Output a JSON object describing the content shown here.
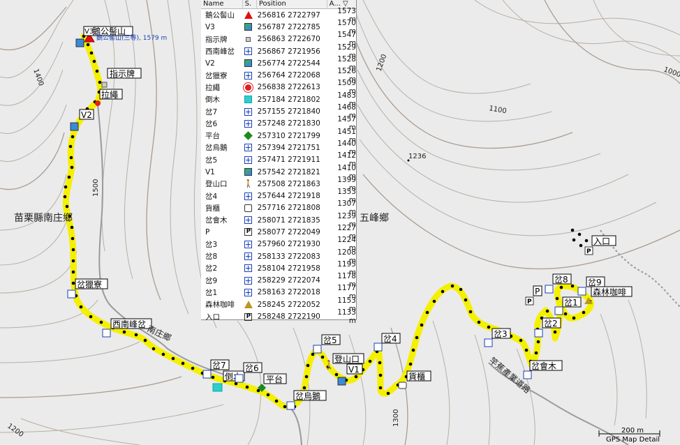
{
  "table": {
    "headers": {
      "name": "Name",
      "symbol": "S.",
      "position": "Position",
      "altitude": "A... ▽"
    },
    "rows": [
      {
        "name": "鵝公髻山",
        "icon": "summit-triangle-icon",
        "position": "256816 2722797",
        "alt": "1573 m"
      },
      {
        "name": "V3",
        "icon": "flag-icon",
        "position": "256787 2722785",
        "alt": "1570 m"
      },
      {
        "name": "指示牌",
        "icon": "sign-square-icon",
        "position": "256863 2722670",
        "alt": "1547 m"
      },
      {
        "name": "西南峰岔",
        "icon": "junction-plus-icon",
        "position": "256867 2721956",
        "alt": "1529 m"
      },
      {
        "name": "V2",
        "icon": "flag-icon",
        "position": "256774 2722544",
        "alt": "1528 m"
      },
      {
        "name": "岔獵寮",
        "icon": "junction-plus-icon",
        "position": "256764 2722068",
        "alt": "1526 m"
      },
      {
        "name": "拉繩",
        "icon": "red-sun-icon",
        "position": "256838 2722613",
        "alt": "1509 m"
      },
      {
        "name": "倒木",
        "icon": "tree-icon",
        "position": "257184 2721802",
        "alt": "1483 m"
      },
      {
        "name": "岔7",
        "icon": "junction-plus-icon",
        "position": "257155 2721840",
        "alt": "1468 m"
      },
      {
        "name": "岔6",
        "icon": "junction-plus-icon",
        "position": "257248 2721830",
        "alt": "1457 m"
      },
      {
        "name": "平台",
        "icon": "green-diamond-icon",
        "position": "257310 2721799",
        "alt": "1451 m"
      },
      {
        "name": "岔烏鵝",
        "icon": "junction-plus-icon",
        "position": "257394 2721751",
        "alt": "1440 m"
      },
      {
        "name": "岔5",
        "icon": "junction-plus-icon",
        "position": "257471 2721911",
        "alt": "1412 m"
      },
      {
        "name": "V1",
        "icon": "flag-icon",
        "position": "257542 2721821",
        "alt": "1410 m"
      },
      {
        "name": "登山口",
        "icon": "hiker-icon",
        "position": "257508 2721863",
        "alt": "1399 m"
      },
      {
        "name": "岔4",
        "icon": "junction-plus-icon",
        "position": "257644 2721918",
        "alt": "1353 m"
      },
      {
        "name": "貨櫃",
        "icon": "container-icon",
        "position": "257716 2721808",
        "alt": "1307 m"
      },
      {
        "name": "岔會木",
        "icon": "junction-plus-icon",
        "position": "258071 2721835",
        "alt": "1239 m"
      },
      {
        "name": "P",
        "icon": "parking-icon",
        "position": "258077 2722049",
        "alt": "1227 m"
      },
      {
        "name": "岔3",
        "icon": "junction-plus-icon",
        "position": "257960 2721930",
        "alt": "1224 m"
      },
      {
        "name": "岔8",
        "icon": "junction-plus-icon",
        "position": "258133 2722083",
        "alt": "1208 m"
      },
      {
        "name": "岔2",
        "icon": "junction-plus-icon",
        "position": "258104 2721958",
        "alt": "1195 m"
      },
      {
        "name": "岔9",
        "icon": "junction-plus-icon",
        "position": "258229 2722074",
        "alt": "1178 m"
      },
      {
        "name": "岔1",
        "icon": "junction-plus-icon",
        "position": "258163 2722018",
        "alt": "1177 m"
      },
      {
        "name": "森林咖啡",
        "icon": "cafe-icon",
        "position": "258245 2722052",
        "alt": "1153 m"
      },
      {
        "name": "入口",
        "icon": "parking-icon",
        "position": "258248 2722190",
        "alt": "1133 m"
      }
    ]
  },
  "map_labels": {
    "summit_note": "鵝公髻山(三等), 1579 m",
    "summit": "鵝公髻山",
    "v3": "V3",
    "sign": "指示牌",
    "rope": "拉繩",
    "v2": "V2",
    "hunt_hut": "岔獵寮",
    "sw_peak": "西南峰岔",
    "fallen_tree": "倒木",
    "j7": "岔7",
    "j6": "岔6",
    "platform": "平台",
    "crow": "岔烏鵝",
    "j5": "岔5",
    "trailhead": "登山口",
    "v1": "V1",
    "j4": "岔4",
    "container": "貨櫃",
    "j3": "岔3",
    "j2": "岔2",
    "j8": "岔8",
    "j9": "岔9",
    "j1": "岔1",
    "p": "P",
    "cafe": "森林咖啡",
    "entrance": "入口",
    "junction_wood": "岔會木",
    "township_w": "苗栗縣南庄鄉",
    "township_e": "五峰鄉",
    "township_s": "南庄鄉",
    "road": "竿蕉產業道路",
    "spot_height": "1236",
    "c1400": "1400",
    "c1500": "1500",
    "c1200_ne": "1200",
    "c1100": "1100",
    "c1000": "1000",
    "c1300": "1300",
    "c1200_sw": "1200"
  },
  "scale": {
    "label": "200 m"
  },
  "footer": "GPS Map Detail"
}
